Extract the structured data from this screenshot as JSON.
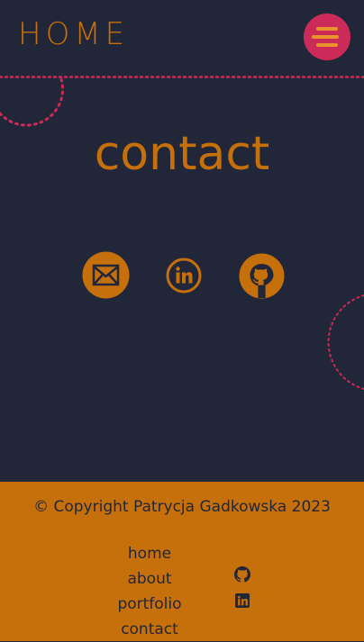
{
  "header": {
    "brand": "HOME",
    "menu_icon": "hamburger-menu-icon"
  },
  "main": {
    "title": "contact",
    "social": [
      {
        "name": "email",
        "icon": "envelope-icon"
      },
      {
        "name": "linkedin",
        "icon": "linkedin-icon"
      },
      {
        "name": "github",
        "icon": "github-icon"
      }
    ]
  },
  "footer": {
    "copyright": "© Copyright Patrycja Gadkowska 2023",
    "nav": [
      "home",
      "about",
      "portfolio",
      "contact"
    ],
    "icons": [
      "github-icon",
      "linkedin-icon"
    ]
  },
  "colors": {
    "background": "#222639",
    "accent": "#c6700c",
    "menu_button": "#cc2a58",
    "decor_dots": "#cc2a58",
    "footer_text": "#222639"
  }
}
